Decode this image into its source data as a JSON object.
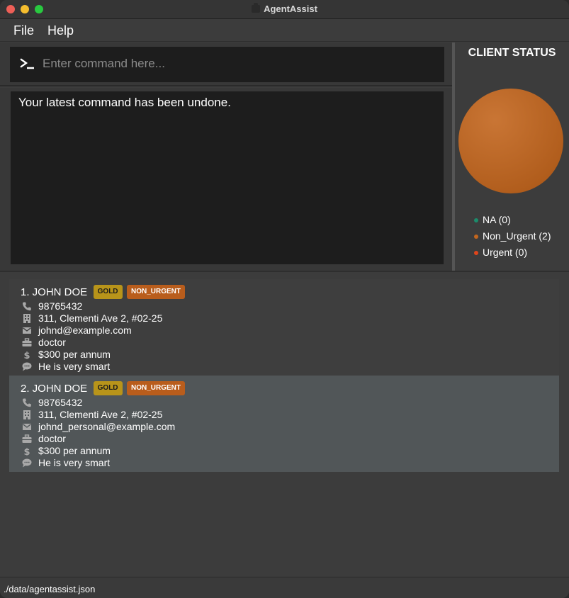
{
  "window": {
    "title": "AgentAssist"
  },
  "menu": {
    "file": "File",
    "help": "Help"
  },
  "command": {
    "placeholder": "Enter command here..."
  },
  "result": {
    "message": "Your latest command has been undone."
  },
  "status_panel": {
    "title": "CLIENT STATUS",
    "chart_data": {
      "type": "pie",
      "title": "CLIENT STATUS",
      "categories": [
        "NA",
        "Non_Urgent",
        "Urgent"
      ],
      "values": [
        0,
        2,
        0
      ],
      "colors": [
        "#1b8c6b",
        "#c3661e",
        "#e0451b"
      ],
      "legend_position": "bottom"
    },
    "legend": [
      {
        "label": "NA (0)",
        "color": "#1b8c6b"
      },
      {
        "label": "Non_Urgent (2)",
        "color": "#c3661e"
      },
      {
        "label": "Urgent (0)",
        "color": "#e0451b"
      }
    ]
  },
  "clients": [
    {
      "name": "1. JOHN DOE",
      "tags": {
        "tier": "GOLD",
        "status": "NON_URGENT"
      },
      "phone": "98765432",
      "address": "311, Clementi Ave 2, #02-25",
      "email": "johnd@example.com",
      "occupation": "doctor",
      "salary": "$300 per annum",
      "remark": "He is very smart"
    },
    {
      "name": "2. JOHN DOE",
      "tags": {
        "tier": "GOLD",
        "status": "NON_URGENT"
      },
      "phone": "98765432",
      "address": "311, Clementi Ave 2, #02-25",
      "email": "johnd_personal@example.com",
      "occupation": "doctor",
      "salary": "$300 per annum",
      "remark": "He is very smart"
    }
  ],
  "statusbar": {
    "path": "./data/agentassist.json"
  },
  "colors": {
    "accent_orange": "#c3661e",
    "tag_gold": "#b8941a",
    "tag_non_urgent": "#b95d1c",
    "selected_row": "#515658"
  }
}
